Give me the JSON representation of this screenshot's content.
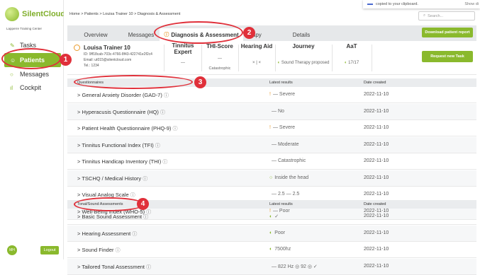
{
  "app": {
    "name": "SilentCloud",
    "subtitle": "Lapperre Training Center"
  },
  "sidebar": {
    "items": [
      {
        "label": "Tasks",
        "icon": "tasks-icon"
      },
      {
        "label": "Patients",
        "icon": "patients-icon"
      },
      {
        "label": "Messages",
        "icon": "messages-icon"
      },
      {
        "label": "Cockpit",
        "icon": "cockpit-icon"
      }
    ],
    "user_initials": "MH",
    "logout_label": "Logout"
  },
  "topbar": {
    "breadcrumb": "Home > Patients > Louisa Trainer 10 > Diagnosis & Assessment",
    "search_placeholder": "Search...",
    "toast_text": "copied to your clipboard.",
    "toast_action": "Show di"
  },
  "tabs": {
    "overview": "Overview",
    "messages": "Messages",
    "diagnosis": "Diagnosis & Assessment",
    "therapy_fragment": "rapy",
    "details": "Details",
    "download_label": "Download patient report"
  },
  "patient": {
    "name": "Louisa Trainer 10",
    "id": "ID: 9ff18cab-703c-4766-8f43-422741e2f2c4",
    "email": "Email: ut015@silentcloud.com",
    "tel": "Tel.: 1234",
    "tinnitus_expert_label_1": "Tinnitus",
    "tinnitus_expert_label_2": "Expert",
    "tinnitus_expert_value": "—",
    "thi_score_label": "THI-Score",
    "thi_score_value": "—",
    "thi_score_sub": "Catastrophic",
    "hearing_aid_label": "Hearing Aid",
    "hearing_aid_value": "× | ×",
    "journey_label": "Journey",
    "journey_value": "Sound Therapy proposed",
    "aat_label": "AaT",
    "aat_value": "17/17",
    "request_label": "Request new Task"
  },
  "questionnaires": {
    "header": "Questionnaires",
    "col_results": "Latest results",
    "col_date": "Date created",
    "rows": [
      {
        "name": "General Anxiety Disorder (GAD-7)",
        "indicator": "!",
        "indicator_color": "#e99a2a",
        "result": "— Severe",
        "date": "2022-11-10"
      },
      {
        "name": "Hyperacusis Questionnaire (HQ)",
        "indicator": "",
        "indicator_color": "#888888",
        "result": "— No",
        "date": "2022-11-10"
      },
      {
        "name": "Patient Health Questionnaire (PHQ-9)",
        "indicator": "!",
        "indicator_color": "#e99a2a",
        "result": "— Severe",
        "date": "2022-11-10"
      },
      {
        "name": "Tinnitus Functional Index (TFI)",
        "indicator": "",
        "indicator_color": "#888888",
        "result": "— Moderate",
        "date": "2022-11-10"
      },
      {
        "name": "Tinnitus Handicap Inventory (THI)",
        "indicator": "",
        "indicator_color": "#888888",
        "result": "— Catastrophic",
        "date": "2022-11-10"
      },
      {
        "name": "TSCHQ / Medical History",
        "indicator": "○",
        "indicator_color": "#8ab92d",
        "result": "Inside the head",
        "date": "2022-11-10"
      },
      {
        "name": "Visual Analog Scale",
        "indicator": "",
        "indicator_color": "#888888",
        "result": "— 2.5  — 2.5",
        "date": "2022-11-10"
      },
      {
        "name": "Well-Being Index (WHO-5)",
        "indicator": "!",
        "indicator_color": "#e99a2a",
        "result": "— Poor",
        "date": "2022-11-10"
      }
    ]
  },
  "tonal": {
    "header": "Tonal/Sound Assessments",
    "col_results": "Latest results",
    "col_date": "Date created",
    "rows": [
      {
        "name": "Basic Sound Assessment",
        "indicator": "◐",
        "indicator_color": "#8ab92d",
        "result": "✓",
        "date": "2022-11-10"
      },
      {
        "name": "Hearing Assessment",
        "indicator": "◐",
        "indicator_color": "#8ab92d",
        "result": "Poor",
        "date": "2022-11-10"
      },
      {
        "name": "Sound Finder",
        "indicator": "◐",
        "indicator_color": "#8ab92d",
        "result": "7500hz",
        "date": "2022-11-10"
      },
      {
        "name": "Tailored Tonal Assessment",
        "indicator": "",
        "indicator_color": "#888888",
        "result": "— 822 Hz  ◎ 92  ◎ ✓",
        "date": "2022-11-10"
      }
    ]
  },
  "callouts": [
    "1",
    "2",
    "3",
    "4"
  ],
  "colors": {
    "accent": "#8ab92d",
    "warning": "#e99a2a",
    "callout": "#e0303a"
  }
}
